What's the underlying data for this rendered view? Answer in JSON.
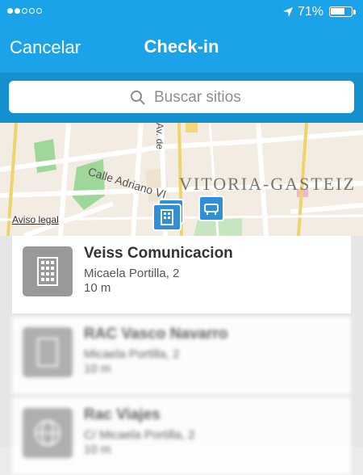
{
  "statusbar": {
    "signal_full": 2,
    "signal_total": 5,
    "location_icon": "location-arrow-icon",
    "battery_percent": "71%",
    "battery_level": 0.71
  },
  "nav": {
    "cancel_label": "Cancelar",
    "title": "Check-in"
  },
  "search": {
    "placeholder": "Buscar sitios",
    "icon": "search-icon"
  },
  "map": {
    "streets": [
      "Calle Adriano VI",
      "Av. de"
    ],
    "city_label": "VITORIA-GASTEIZ",
    "legal_link": "Aviso legal",
    "pins": [
      "building-pin-icon",
      "bus-stop-pin-icon"
    ]
  },
  "places": [
    {
      "name": "Veiss Comunicacion",
      "address": "Micaela Portilla, 2",
      "distance": "10 m",
      "icon": "building-icon"
    },
    {
      "name": "RAC Vasco Navarro",
      "address": "Micaela Portilla, 2",
      "distance": "10 m",
      "icon": "building-icon"
    },
    {
      "name": "Rac Viajes",
      "address": "C/ Micaela Portilla, 2",
      "distance": "10 m",
      "icon": "globe-icon"
    }
  ],
  "colors": {
    "header": "#1aa3e8",
    "search_bar": "#1590cf",
    "pin": "#2f8fd8"
  }
}
